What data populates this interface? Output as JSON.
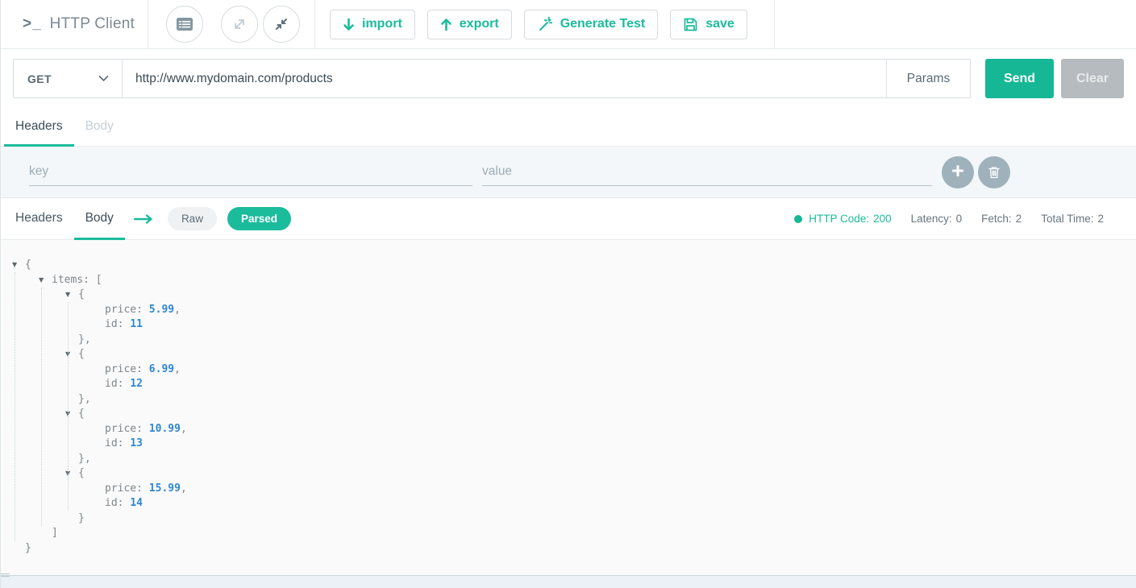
{
  "header": {
    "prompt_icon": ">_",
    "title": "HTTP Client",
    "actions": [
      {
        "label": "import",
        "icon": "arrow-down-icon"
      },
      {
        "label": "export",
        "icon": "arrow-up-icon"
      },
      {
        "label": "Generate Test",
        "icon": "magic-wand-icon"
      },
      {
        "label": "save",
        "icon": "floppy-disk-icon"
      }
    ],
    "window_controls": [
      "form-view-icon",
      "expand-icon",
      "collapse-icon"
    ]
  },
  "request": {
    "method": "GET",
    "url": "http://www.mydomain.com/products",
    "params_label": "Params",
    "send_label": "Send",
    "clear_label": "Clear",
    "tabs": [
      {
        "label": "Headers",
        "active": true
      },
      {
        "label": "Body",
        "active": false
      }
    ],
    "header_kv": {
      "key_placeholder": "key",
      "value_placeholder": "value"
    }
  },
  "response": {
    "tabs": [
      {
        "label": "Headers",
        "active": false
      },
      {
        "label": "Body",
        "active": true
      }
    ],
    "view_modes": [
      {
        "label": "Raw",
        "active": false
      },
      {
        "label": "Parsed",
        "active": true
      }
    ],
    "status": {
      "http_code_label": "HTTP Code:",
      "http_code": "200",
      "latency_label": "Latency:",
      "latency": "0",
      "fetch_label": "Fetch:",
      "fetch": "2",
      "total_time_label": "Total Time:",
      "total_time": "2"
    },
    "body_json": {
      "items": [
        {
          "price": 5.99,
          "id": 11
        },
        {
          "price": 6.99,
          "id": 12
        },
        {
          "price": 10.99,
          "id": 13
        },
        {
          "price": 15.99,
          "id": 14
        }
      ]
    },
    "tree_lines": [
      {
        "indent": 0,
        "toggle": true,
        "segments": [
          {
            "text": "{",
            "type": "plain"
          }
        ]
      },
      {
        "indent": 1,
        "toggle": true,
        "segments": [
          {
            "text": "items: [",
            "type": "plain"
          }
        ]
      },
      {
        "indent": 2,
        "toggle": true,
        "segments": [
          {
            "text": "{",
            "type": "plain"
          }
        ]
      },
      {
        "indent": 3,
        "toggle": false,
        "segments": [
          {
            "text": "price: ",
            "type": "plain"
          },
          {
            "text": "5.99",
            "type": "number"
          },
          {
            "text": ",",
            "type": "plain"
          }
        ]
      },
      {
        "indent": 3,
        "toggle": false,
        "segments": [
          {
            "text": "id: ",
            "type": "plain"
          },
          {
            "text": "11",
            "type": "number"
          }
        ]
      },
      {
        "indent": 2,
        "toggle": false,
        "segments": [
          {
            "text": "},",
            "type": "plain"
          }
        ]
      },
      {
        "indent": 2,
        "toggle": true,
        "segments": [
          {
            "text": "{",
            "type": "plain"
          }
        ]
      },
      {
        "indent": 3,
        "toggle": false,
        "segments": [
          {
            "text": "price: ",
            "type": "plain"
          },
          {
            "text": "6.99",
            "type": "number"
          },
          {
            "text": ",",
            "type": "plain"
          }
        ]
      },
      {
        "indent": 3,
        "toggle": false,
        "segments": [
          {
            "text": "id: ",
            "type": "plain"
          },
          {
            "text": "12",
            "type": "number"
          }
        ]
      },
      {
        "indent": 2,
        "toggle": false,
        "segments": [
          {
            "text": "},",
            "type": "plain"
          }
        ]
      },
      {
        "indent": 2,
        "toggle": true,
        "segments": [
          {
            "text": "{",
            "type": "plain"
          }
        ]
      },
      {
        "indent": 3,
        "toggle": false,
        "segments": [
          {
            "text": "price: ",
            "type": "plain"
          },
          {
            "text": "10.99",
            "type": "number"
          },
          {
            "text": ",",
            "type": "plain"
          }
        ]
      },
      {
        "indent": 3,
        "toggle": false,
        "segments": [
          {
            "text": "id: ",
            "type": "plain"
          },
          {
            "text": "13",
            "type": "number"
          }
        ]
      },
      {
        "indent": 2,
        "toggle": false,
        "segments": [
          {
            "text": "},",
            "type": "plain"
          }
        ]
      },
      {
        "indent": 2,
        "toggle": true,
        "segments": [
          {
            "text": "{",
            "type": "plain"
          }
        ]
      },
      {
        "indent": 3,
        "toggle": false,
        "segments": [
          {
            "text": "price: ",
            "type": "plain"
          },
          {
            "text": "15.99",
            "type": "number"
          },
          {
            "text": ",",
            "type": "plain"
          }
        ]
      },
      {
        "indent": 3,
        "toggle": false,
        "segments": [
          {
            "text": "id: ",
            "type": "plain"
          },
          {
            "text": "14",
            "type": "number"
          }
        ]
      },
      {
        "indent": 2,
        "toggle": false,
        "segments": [
          {
            "text": "}",
            "type": "plain"
          }
        ]
      },
      {
        "indent": 1,
        "toggle": false,
        "segments": [
          {
            "text": "]",
            "type": "plain"
          }
        ]
      },
      {
        "indent": 0,
        "toggle": false,
        "segments": [
          {
            "text": "}",
            "type": "plain"
          }
        ]
      }
    ]
  },
  "colors": {
    "accent": "#1abc9c",
    "send_button": "#16b795",
    "clear_button": "#b5bbbe",
    "status_green": "#16b795",
    "json_number_blue": "#2f87d4",
    "kv_section_bg": "#f3f7f9"
  }
}
